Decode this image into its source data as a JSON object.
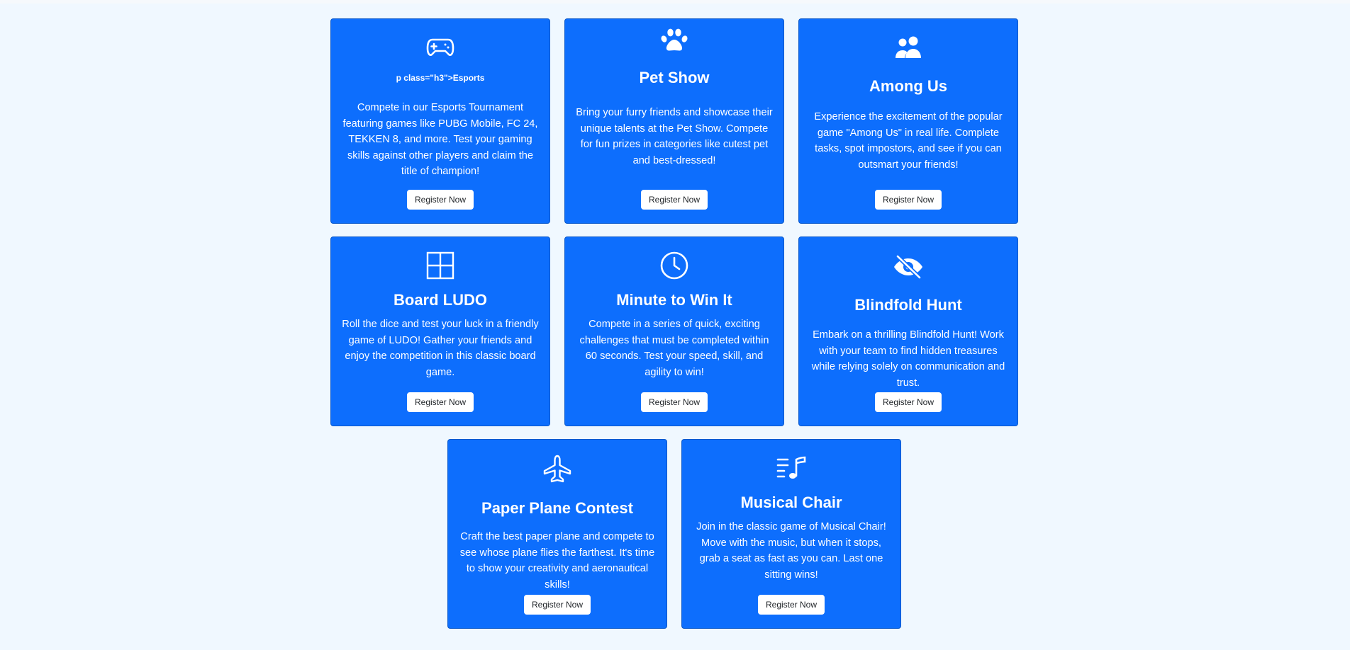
{
  "cards": [
    {
      "icon": "gamepad-icon",
      "title": "p class=\"h3\">Esports",
      "description": "Compete in our Esports Tournament featuring games like PUBG Mobile, FC 24, TEKKEN 8, and more. Test your gaming skills against other players and claim the title of champion!",
      "button": "Register Now"
    },
    {
      "icon": "paw-icon",
      "title": "Pet Show",
      "description": "Bring your furry friends and showcase their unique talents at the Pet Show. Compete for fun prizes in categories like cutest pet and best-dressed!",
      "button": "Register Now"
    },
    {
      "icon": "people-icon",
      "title": "Among Us",
      "description": "Experience the excitement of the popular game \"Among Us\" in real life. Complete tasks, spot impostors, and see if you can outsmart your friends!",
      "button": "Register Now"
    },
    {
      "icon": "grid-icon",
      "title": "Board LUDO",
      "description": "Roll the dice and test your luck in a friendly game of LUDO! Gather your friends and enjoy the competition in this classic board game.",
      "button": "Register Now"
    },
    {
      "icon": "clock-icon",
      "title": "Minute to Win It",
      "description": "Compete in a series of quick, exciting challenges that must be completed within 60 seconds. Test your speed, skill, and agility to win!",
      "button": "Register Now"
    },
    {
      "icon": "eye-slash-icon",
      "title": "Blindfold Hunt",
      "description": "Embark on a thrilling Blindfold Hunt! Work with your team to find hidden treasures while relying solely on communication and trust.",
      "button": "Register Now"
    },
    {
      "icon": "airplane-icon",
      "title": "Paper Plane Contest",
      "description": "Craft the best paper plane and compete to see whose plane flies the farthest. It's time to show your creativity and aeronautical skills!",
      "button": "Register Now"
    },
    {
      "icon": "music-note-list-icon",
      "title": "Musical Chair",
      "description": "Join in the classic game of Musical Chair! Move with the music, but when it stops, grab a seat as fast as you can. Last one sitting wins!",
      "button": "Register Now"
    }
  ],
  "colors": {
    "background": "#f0f8ff",
    "card": "#0d6efd",
    "card_text": "#ffffff",
    "button_bg": "#ffffff",
    "button_text": "#212529"
  }
}
